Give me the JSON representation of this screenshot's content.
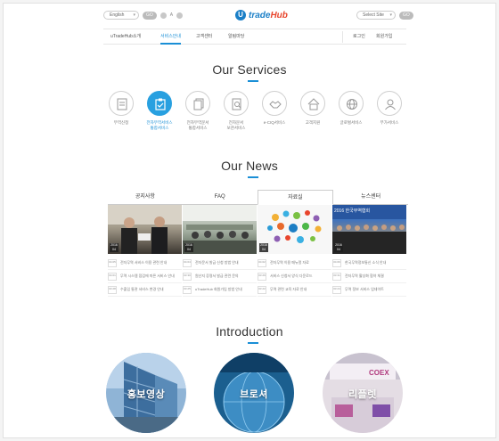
{
  "topbar": {
    "left_select": "English",
    "left_pill": "GO",
    "left_small": "A",
    "logo_prefix": "U",
    "logo_text_main": "trade",
    "logo_text_accent": "Hub",
    "right_select": "Select Site",
    "right_pill": "GO"
  },
  "nav": {
    "items": [
      {
        "label": "uTradeHub소개"
      },
      {
        "label": "서비스안내"
      },
      {
        "label": "고객센터"
      },
      {
        "label": "알림마당"
      },
      {
        "label": "로그인"
      },
      {
        "label": "회원가입"
      }
    ]
  },
  "services": {
    "title": "Our Services",
    "items": [
      {
        "label": "무역신청",
        "icon": "document-icon"
      },
      {
        "label": "전자무역서비스\n통합서비스",
        "icon": "clipboard-check-icon"
      },
      {
        "label": "전자무역문서\n통합서비스",
        "icon": "stacked-docs-icon"
      },
      {
        "label": "전자문서\n보관서비스",
        "icon": "search-doc-icon"
      },
      {
        "label": "e-CIQ서비스",
        "icon": "handshake-icon"
      },
      {
        "label": "고객지원",
        "icon": "home-icon"
      },
      {
        "label": "글로벌서비스",
        "icon": "globe-icon"
      },
      {
        "label": "부가서비스",
        "icon": "user-icon"
      }
    ]
  },
  "news": {
    "title": "Our News",
    "tabs": [
      {
        "label": "공지사항"
      },
      {
        "label": "FAQ"
      },
      {
        "label": "자료실"
      },
      {
        "label": "뉴스센터"
      }
    ],
    "columns": [
      {
        "date": "2016 04",
        "rows": [
          {
            "date": "04 05",
            "title": "전자무역 서비스 이용 관련 안내"
          },
          {
            "date": "04 01",
            "title": "무역 시스템 점검에 따른 서비스 안내"
          },
          {
            "date": "03 28",
            "title": "수출입 통관 서비스 변경 안내"
          }
        ]
      },
      {
        "date": "2016 04",
        "rows": [
          {
            "date": "04 04",
            "title": "전자문서 발급 신청 방법 안내"
          },
          {
            "date": "03 30",
            "title": "원산지 증명서 발급 관련 문의"
          },
          {
            "date": "03 25",
            "title": "uTradeHub 회원가입 방법 안내"
          }
        ]
      },
      {
        "date": "2016 04",
        "rows": [
          {
            "date": "04 02",
            "title": "전자무역 이용 매뉴얼 자료"
          },
          {
            "date": "03 29",
            "title": "서비스 신청서 양식 다운로드"
          },
          {
            "date": "03 22",
            "title": "무역 관련 교육 자료 안내"
          }
        ]
      },
      {
        "date": "2016 04",
        "banner": "2016 한국무역협회",
        "rows": [
          {
            "date": "04 06",
            "title": "한국무역정보통신 소식 안내"
          },
          {
            "date": "03 31",
            "title": "전자무역 활성화 협약 체결"
          },
          {
            "date": "03 24",
            "title": "무역 정보 서비스 업데이트"
          }
        ]
      }
    ]
  },
  "introduction": {
    "title": "Introduction",
    "items": [
      {
        "label": "홍보영상"
      },
      {
        "label": "브로셔"
      },
      {
        "label": "리플렛",
        "overlay_text": "COEX"
      }
    ]
  },
  "colors": {
    "accent": "#1a8fd6",
    "logo_blue": "#1a7fc7",
    "logo_red": "#e8452c",
    "active_service": "#28a0e0"
  }
}
